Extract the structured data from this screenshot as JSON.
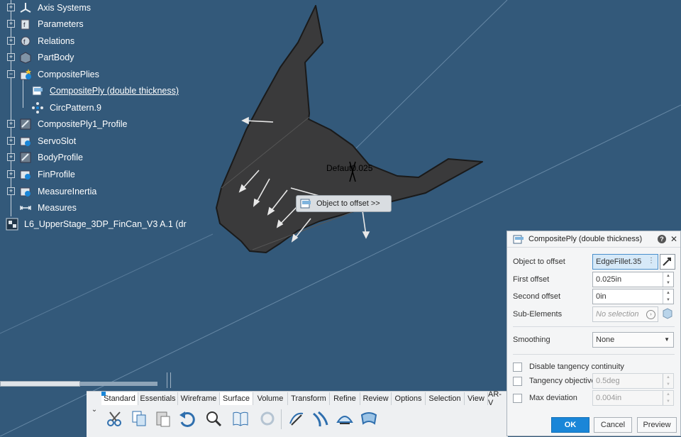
{
  "tree": {
    "items": [
      {
        "label": "Axis Systems"
      },
      {
        "label": "Parameters"
      },
      {
        "label": "Relations"
      },
      {
        "label": "PartBody"
      },
      {
        "label": "CompositePlies"
      },
      {
        "label": "CompositePly (double thickness)"
      },
      {
        "label": "CircPattern.9"
      },
      {
        "label": "CompositePly1_Profile"
      },
      {
        "label": "ServoSlot"
      },
      {
        "label": "BodyProfile"
      },
      {
        "label": "FinProfile"
      },
      {
        "label": "MeasureInertia"
      },
      {
        "label": "Measures"
      },
      {
        "label": "L6_UpperStage_3DP_FinCan_V3 A.1 (dr"
      }
    ]
  },
  "viewport": {
    "overlay_text": "Defaut0.025",
    "tooltip": "Object to offset >>"
  },
  "panel": {
    "title": "CompositePly (double thickness)",
    "help": "?",
    "close": "✕",
    "fields": {
      "object_to_offset_label": "Object to offset",
      "object_to_offset_value": "EdgeFillet.35",
      "first_offset_label": "First offset",
      "first_offset_value": "0.025in",
      "second_offset_label": "Second offset",
      "second_offset_value": "0in",
      "sub_elements_label": "Sub-Elements",
      "sub_elements_placeholder": "No selection",
      "smoothing_label": "Smoothing",
      "smoothing_value": "None",
      "disable_tangency_label": "Disable tangency continuity",
      "tangency_objective_label": "Tangency objective",
      "tangency_objective_value": "0.5deg",
      "max_deviation_label": "Max deviation",
      "max_deviation_value": "0.004in"
    },
    "buttons": {
      "ok": "OK",
      "cancel": "Cancel",
      "preview": "Preview"
    }
  },
  "toolbar": {
    "tabs": [
      "Standard",
      "Essentials",
      "Wireframe",
      "Surface",
      "Volume",
      "Transform",
      "Refine",
      "Review",
      "Options",
      "Selection",
      "View",
      "AR-V"
    ],
    "active_tab": "Surface",
    "tools": [
      "cut-icon",
      "copy-icon",
      "paste-icon",
      "undo-icon",
      "zoom-icon",
      "book-icon",
      "refresh-icon",
      "sketch-icon",
      "sweep-icon",
      "offset-icon",
      "surface-icon"
    ]
  },
  "colors": {
    "background": "#33597a",
    "accent": "#1a86d8",
    "part": "#3a3a3b"
  }
}
